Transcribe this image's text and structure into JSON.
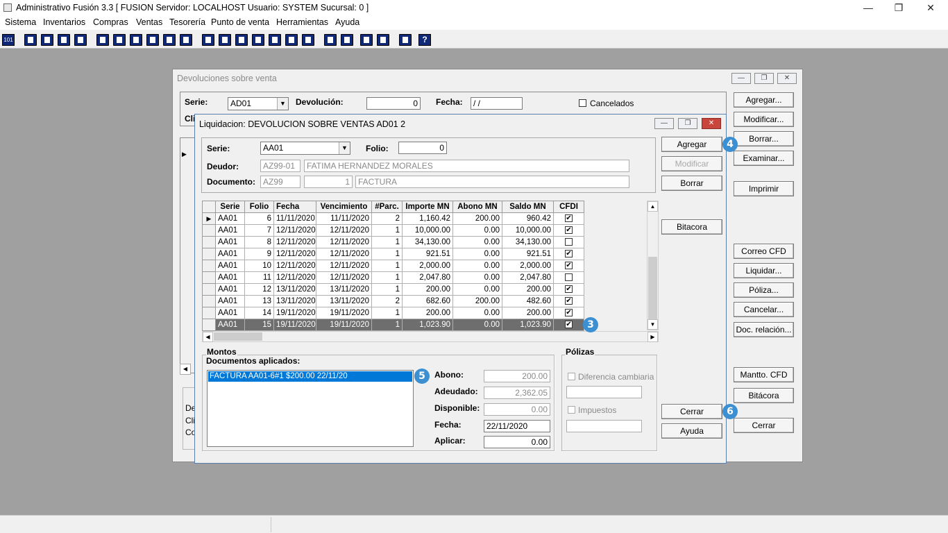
{
  "app": {
    "title": "Administrativo Fusión 3.3 [ FUSION  Servidor: LOCALHOST   Usuario: SYSTEM    Sucursal: 0 ]",
    "window_controls": [
      "—",
      "❐",
      "✕"
    ]
  },
  "menu": [
    "Sistema",
    "Inventarios",
    "Compras",
    "Ventas",
    "Tesorería",
    "Punto de venta",
    "Herramientas",
    "Ayuda"
  ],
  "toolbar": {
    "first_label": "101",
    "help_label": "?"
  },
  "devoluciones": {
    "title": "Devoluciones sobre venta",
    "serie_label": "Serie:",
    "serie_value": "AD01",
    "devolucion_label": "Devolución:",
    "devolucion_value": "0",
    "fecha_label": "Fecha:",
    "fecha_value": "/ /",
    "cancelados_label": "Cancelados",
    "cli_label": "Cli",
    "bottom_labels": [
      "De",
      "Clie",
      "Co"
    ],
    "buttons": [
      "Agregar...",
      "Modificar...",
      "Borrar...",
      "Examinar...",
      "Imprimir",
      "Correo CFD",
      "Liquidar...",
      "Póliza...",
      "Cancelar...",
      "Doc. relación...",
      "Mantto. CFD",
      "Bitácora",
      "Cerrar"
    ]
  },
  "liquidacion": {
    "title": "Liquidacion: DEVOLUCION SOBRE VENTAS AD01 2",
    "serie_label": "Serie:",
    "serie_value": "AA01",
    "folio_label": "Folio:",
    "folio_value": "0",
    "deudor_label": "Deudor:",
    "deudor_code": "AZ99-01",
    "deudor_name": "FATIMA HERNANDEZ MORALES",
    "documento_label": "Documento:",
    "documento_code": "AZ99",
    "documento_num": "1",
    "documento_type": "FACTURA",
    "buttons": {
      "agregar": "Agregar",
      "modificar": "Modificar",
      "borrar": "Borrar",
      "bitacora": "Bitacora",
      "cerrar": "Cerrar",
      "ayuda": "Ayuda"
    },
    "columns": [
      "Serie",
      "Folio",
      "Fecha",
      "Vencimiento",
      "#Parc.",
      "Importe MN",
      "Abono MN",
      "Saldo MN",
      "CFDI"
    ],
    "rows": [
      {
        "serie": "AA01",
        "folio": "6",
        "fecha": "11/11/2020",
        "vencimiento": "11/11/2020",
        "parc": "2",
        "importe": "1,160.42",
        "abono": "200.00",
        "saldo": "960.42",
        "cfdi": true
      },
      {
        "serie": "AA01",
        "folio": "7",
        "fecha": "12/11/2020",
        "vencimiento": "12/11/2020",
        "parc": "1",
        "importe": "10,000.00",
        "abono": "0.00",
        "saldo": "10,000.00",
        "cfdi": true
      },
      {
        "serie": "AA01",
        "folio": "8",
        "fecha": "12/11/2020",
        "vencimiento": "12/11/2020",
        "parc": "1",
        "importe": "34,130.00",
        "abono": "0.00",
        "saldo": "34,130.00",
        "cfdi": false
      },
      {
        "serie": "AA01",
        "folio": "9",
        "fecha": "12/11/2020",
        "vencimiento": "12/11/2020",
        "parc": "1",
        "importe": "921.51",
        "abono": "0.00",
        "saldo": "921.51",
        "cfdi": true
      },
      {
        "serie": "AA01",
        "folio": "10",
        "fecha": "12/11/2020",
        "vencimiento": "12/11/2020",
        "parc": "1",
        "importe": "2,000.00",
        "abono": "0.00",
        "saldo": "2,000.00",
        "cfdi": true
      },
      {
        "serie": "AA01",
        "folio": "11",
        "fecha": "12/11/2020",
        "vencimiento": "12/11/2020",
        "parc": "1",
        "importe": "2,047.80",
        "abono": "0.00",
        "saldo": "2,047.80",
        "cfdi": false
      },
      {
        "serie": "AA01",
        "folio": "12",
        "fecha": "13/11/2020",
        "vencimiento": "13/11/2020",
        "parc": "1",
        "importe": "200.00",
        "abono": "0.00",
        "saldo": "200.00",
        "cfdi": true
      },
      {
        "serie": "AA01",
        "folio": "13",
        "fecha": "13/11/2020",
        "vencimiento": "13/11/2020",
        "parc": "2",
        "importe": "682.60",
        "abono": "200.00",
        "saldo": "482.60",
        "cfdi": true
      },
      {
        "serie": "AA01",
        "folio": "14",
        "fecha": "19/11/2020",
        "vencimiento": "19/11/2020",
        "parc": "1",
        "importe": "200.00",
        "abono": "0.00",
        "saldo": "200.00",
        "cfdi": true
      },
      {
        "serie": "AA01",
        "folio": "15",
        "fecha": "19/11/2020",
        "vencimiento": "19/11/2020",
        "parc": "1",
        "importe": "1,023.90",
        "abono": "0.00",
        "saldo": "1,023.90",
        "cfdi": true
      }
    ],
    "montos": {
      "title": "Montos",
      "docs_label": "Documentos aplicados:",
      "docs": [
        "FACTURA AA01-6#1 $200.00 22/11/20"
      ],
      "abono_label": "Abono:",
      "abono_value": "200.00",
      "adeudado_label": "Adeudado:",
      "adeudado_value": "2,362.05",
      "disponible_label": "Disponible:",
      "disponible_value": "0.00",
      "fecha_label": "Fecha:",
      "fecha_value": "22/11/2020",
      "aplicar_label": "Aplicar:",
      "aplicar_value": "0.00"
    },
    "polizas": {
      "title": "Pólizas",
      "dif_label": "Diferencia cambiaria",
      "imp_label": "Impuestos"
    }
  },
  "badges": [
    "3",
    "4",
    "5",
    "6"
  ]
}
